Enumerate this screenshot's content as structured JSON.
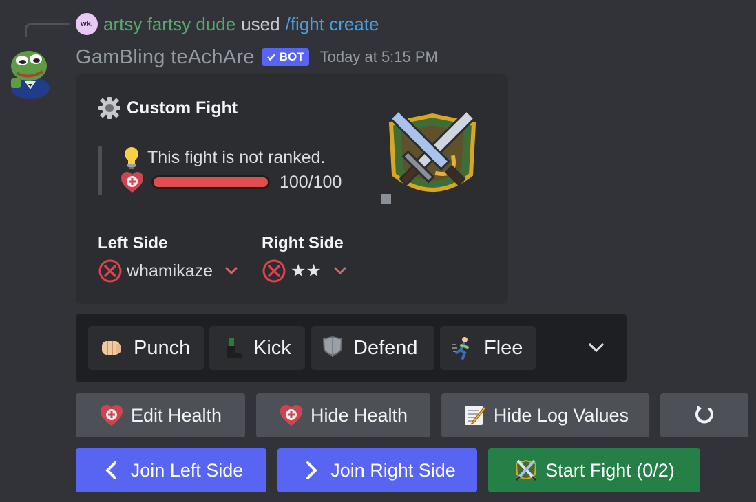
{
  "reply": {
    "avatar_text": "wk.",
    "user": "artsy fartsy dude",
    "used": "used",
    "command": "/fight create"
  },
  "header": {
    "bot_name": "GamBling teAchAre",
    "badge": "BOT",
    "timestamp": "Today at 5:15 PM"
  },
  "embed": {
    "title": "Custom Fight",
    "ranked_text": "This fight is not ranked.",
    "health_value": 100,
    "health_text": "100/100",
    "left_side": {
      "name": "Left Side",
      "player": "whamikaze"
    },
    "right_side": {
      "name": "Right Side",
      "player": "★★"
    }
  },
  "select": {
    "options": [
      {
        "label": "Punch",
        "icon": "fist-icon"
      },
      {
        "label": "Kick",
        "icon": "boot-icon"
      },
      {
        "label": "Defend",
        "icon": "shield-icon"
      },
      {
        "label": "Flee",
        "icon": "running-person-icon"
      }
    ]
  },
  "buttons": {
    "edit_health": "Edit Health",
    "hide_health": "Hide Health",
    "hide_log_values": "Hide Log Values",
    "join_left": "Join Left Side",
    "join_right": "Join Right Side",
    "start_fight": "Start Fight (0/2)"
  },
  "colors": {
    "background": "#313338",
    "embed": "#2b2d31",
    "blurple": "#5865f2",
    "green": "#248046",
    "gray_button": "#4e5058",
    "health_fill": "#e24c4c"
  }
}
